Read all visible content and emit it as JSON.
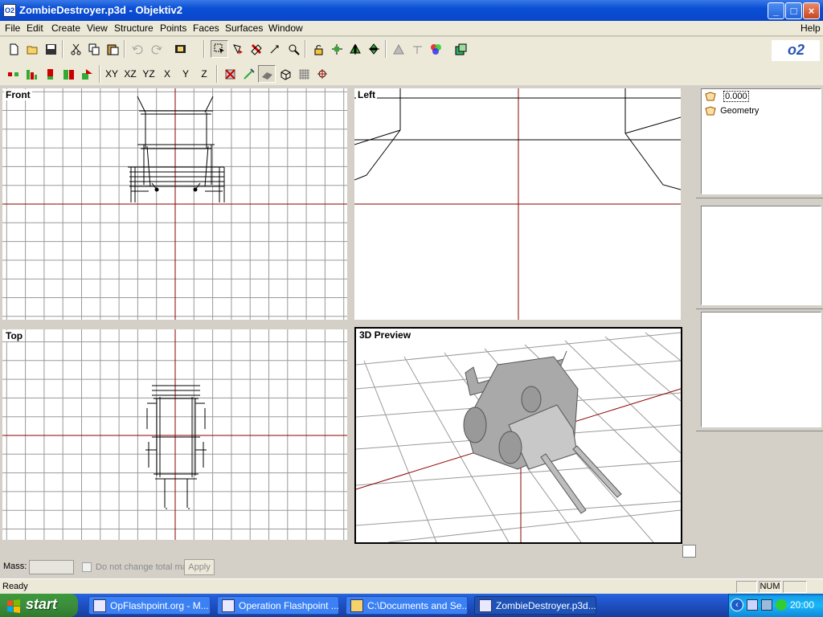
{
  "window": {
    "title": "ZombieDestroyer.p3d - Objektiv2",
    "app_icon_text": "O2"
  },
  "menu": [
    "File",
    "Edit",
    "Create",
    "View",
    "Structure",
    "Points",
    "Faces",
    "Surfaces",
    "Window"
  ],
  "menu_help": "Help",
  "logo_text": "o2",
  "toolbar2_axes": [
    "XY",
    "XZ",
    "YZ",
    "X",
    "Y",
    "Z"
  ],
  "viewports": {
    "front": "Front",
    "left": "Left",
    "top": "Top",
    "preview": "3D Preview"
  },
  "lod_list": [
    {
      "label": "0.000",
      "selected": true
    },
    {
      "label": "Geometry",
      "selected": false
    }
  ],
  "mass": {
    "label": "Mass:",
    "value": "",
    "checkbox_label": "Do not change total ma",
    "apply_label": "Apply"
  },
  "status": {
    "text": "Ready",
    "num": "NUM"
  },
  "taskbar": {
    "start_label": "start",
    "tasks": [
      {
        "label": "OpFlashpoint.org - M...",
        "active": false
      },
      {
        "label": "Operation Flashpoint ...",
        "active": false
      },
      {
        "label": "C:\\Documents and Se...",
        "active": false
      },
      {
        "label": "ZombieDestroyer.p3d...",
        "active": true
      }
    ],
    "clock": "20:00"
  },
  "colors": {
    "grid": "#808080",
    "axis": "#8b0000",
    "model": "#000000",
    "preview_model": "#a9a9a9"
  }
}
